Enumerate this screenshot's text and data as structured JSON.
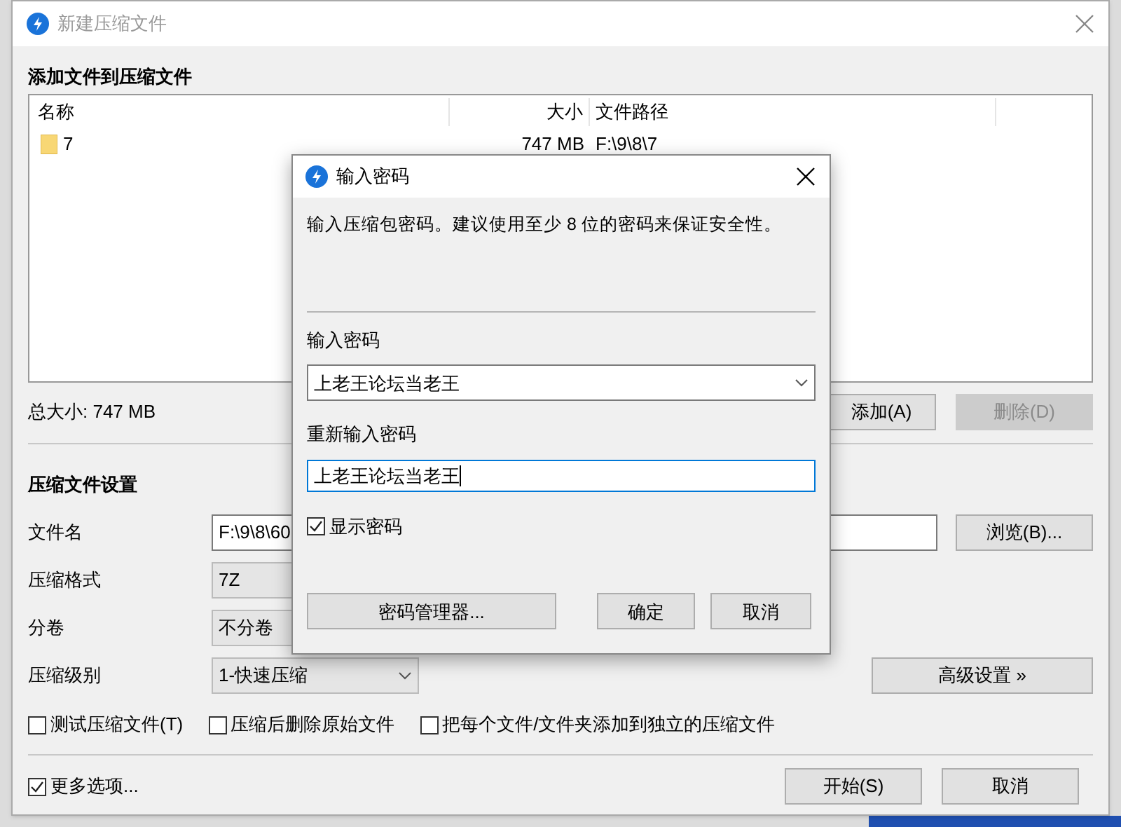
{
  "main_window": {
    "title": "新建压缩文件",
    "files_section": {
      "heading": "添加文件到压缩文件",
      "columns": [
        "名称",
        "大小",
        "文件路径"
      ],
      "rows": [
        {
          "name": "7",
          "size": "747 MB",
          "path": "F:\\9\\8\\7"
        }
      ],
      "total": "总大小: 747 MB",
      "buttons": [
        {
          "label": "添加(A)",
          "disabled": false
        },
        {
          "label": "删除(D)",
          "disabled": true
        }
      ]
    },
    "settings": {
      "heading": "压缩文件设置",
      "fields": [
        {
          "kind": "input",
          "label": "文件名",
          "value": "F:\\9\\8\\60",
          "button": "浏览(B)..."
        },
        {
          "kind": "select",
          "label": "压缩格式",
          "value": "7Z"
        },
        {
          "kind": "select",
          "label": "分卷",
          "value": "不分卷"
        },
        {
          "kind": "dropdown",
          "label": "压缩级别",
          "value": "1-快速压缩",
          "button": "高级设置 »"
        }
      ],
      "options": [
        {
          "label": "测试压缩文件(T)",
          "checked": false
        },
        {
          "label": "压缩后删除原始文件",
          "checked": false
        },
        {
          "label": "把每个文件/文件夹添加到独立的压缩文件",
          "checked": false
        }
      ]
    },
    "more_options": {
      "label": "更多选项...",
      "checked": true
    },
    "buttons": [
      "开始(S)",
      "取消"
    ]
  },
  "password_dialog": {
    "title": "输入密码",
    "description": "输入压缩包密码。建议使用至少 8 位的密码来保证安全性。",
    "password_label": "输入密码",
    "password_value": "上老王论坛当老王",
    "confirm_label": "重新输入密码",
    "confirm_value": "上老王论坛当老王",
    "show_password": {
      "label": "显示密码",
      "checked": true
    },
    "manager_button": "密码管理器...",
    "buttons": [
      "确定",
      "取消"
    ]
  }
}
